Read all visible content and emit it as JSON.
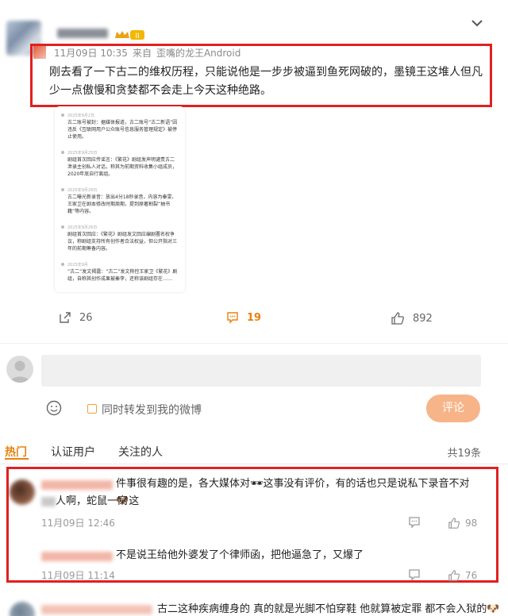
{
  "post": {
    "timestamp": "11月09日 10:35",
    "source_prefix": "来自",
    "source_name": "歪嘴的龙王Android",
    "vip_level": "II",
    "text": "刚去看了一下古二的维权历程，只能说他是一步步被逼到鱼死网破的，墨镜王这堆人但凡少一点傲慢和贪婪都不会走上今天这种绝路。",
    "actions": {
      "forward_count": "26",
      "comment_count": "19",
      "like_count": "892"
    }
  },
  "embed_image": {
    "entries": [
      {
        "date": "2025年9月2日",
        "text": "古二账号被封：据媒体报道，古二账号“古二新语”因违反《互联网用户公众账号信息服务管理规定》被停止使用。"
      },
      {
        "date": "2025年9月25日",
        "text": "剧组首次回应传谣言：《繁花》剧组发声明谴责古二泄录主创私人对话，称其为前期资料收集小组成员，2020年底自行离组。"
      },
      {
        "date": "2025年9月26日",
        "text": "古二曝光新录音：放出4分18秒录音，内容为秦雯、王家卫在剧本修改时期周期，提到原著割裂“抽书籍”等内容。"
      },
      {
        "date": "2025年9月26日",
        "text": "剧组首次回应：《繁花》剧组发文回应编剧署名权争议，称剧组支持所有创作者合法权益，但公开指对三年的前期筹备内容。"
      },
      {
        "date": "2025年9月",
        "text": "“古二”发文揭露：“古二”发文称控王家卫《繁花》剧组，自称其创作成果被秦李，还称该剧组存在……"
      }
    ]
  },
  "composer": {
    "placeholder": "",
    "checkbox_label": "同时转发到我的微博",
    "submit_label": "评论"
  },
  "tabs": {
    "hot": "热门",
    "verified": "认证用户",
    "following": "关注的人",
    "total": "共19条"
  },
  "comments": [
    {
      "text_part1": "件事很有趣的是，各大媒体对",
      "text_part2": "这事没有评价，有的话也只是说私下录音不对",
      "text_part3": "这",
      "text_line2": "人啊，蛇鼠一窝",
      "time": "11月09日 12:46",
      "likes": "98"
    },
    {
      "text": "不是说王给他外婆发了个律师函，把他逼急了，又爆了",
      "time": "11月09日 11:14",
      "likes": "76"
    },
    {
      "text": "古二这种疾病缠身的 真的就是光脚不怕穿鞋 他就算被定罪 都不会入狱的"
    }
  ],
  "colors": {
    "accent": "#e8820e",
    "highlight_box": "#e02020",
    "submit_button": "#f7b488"
  }
}
